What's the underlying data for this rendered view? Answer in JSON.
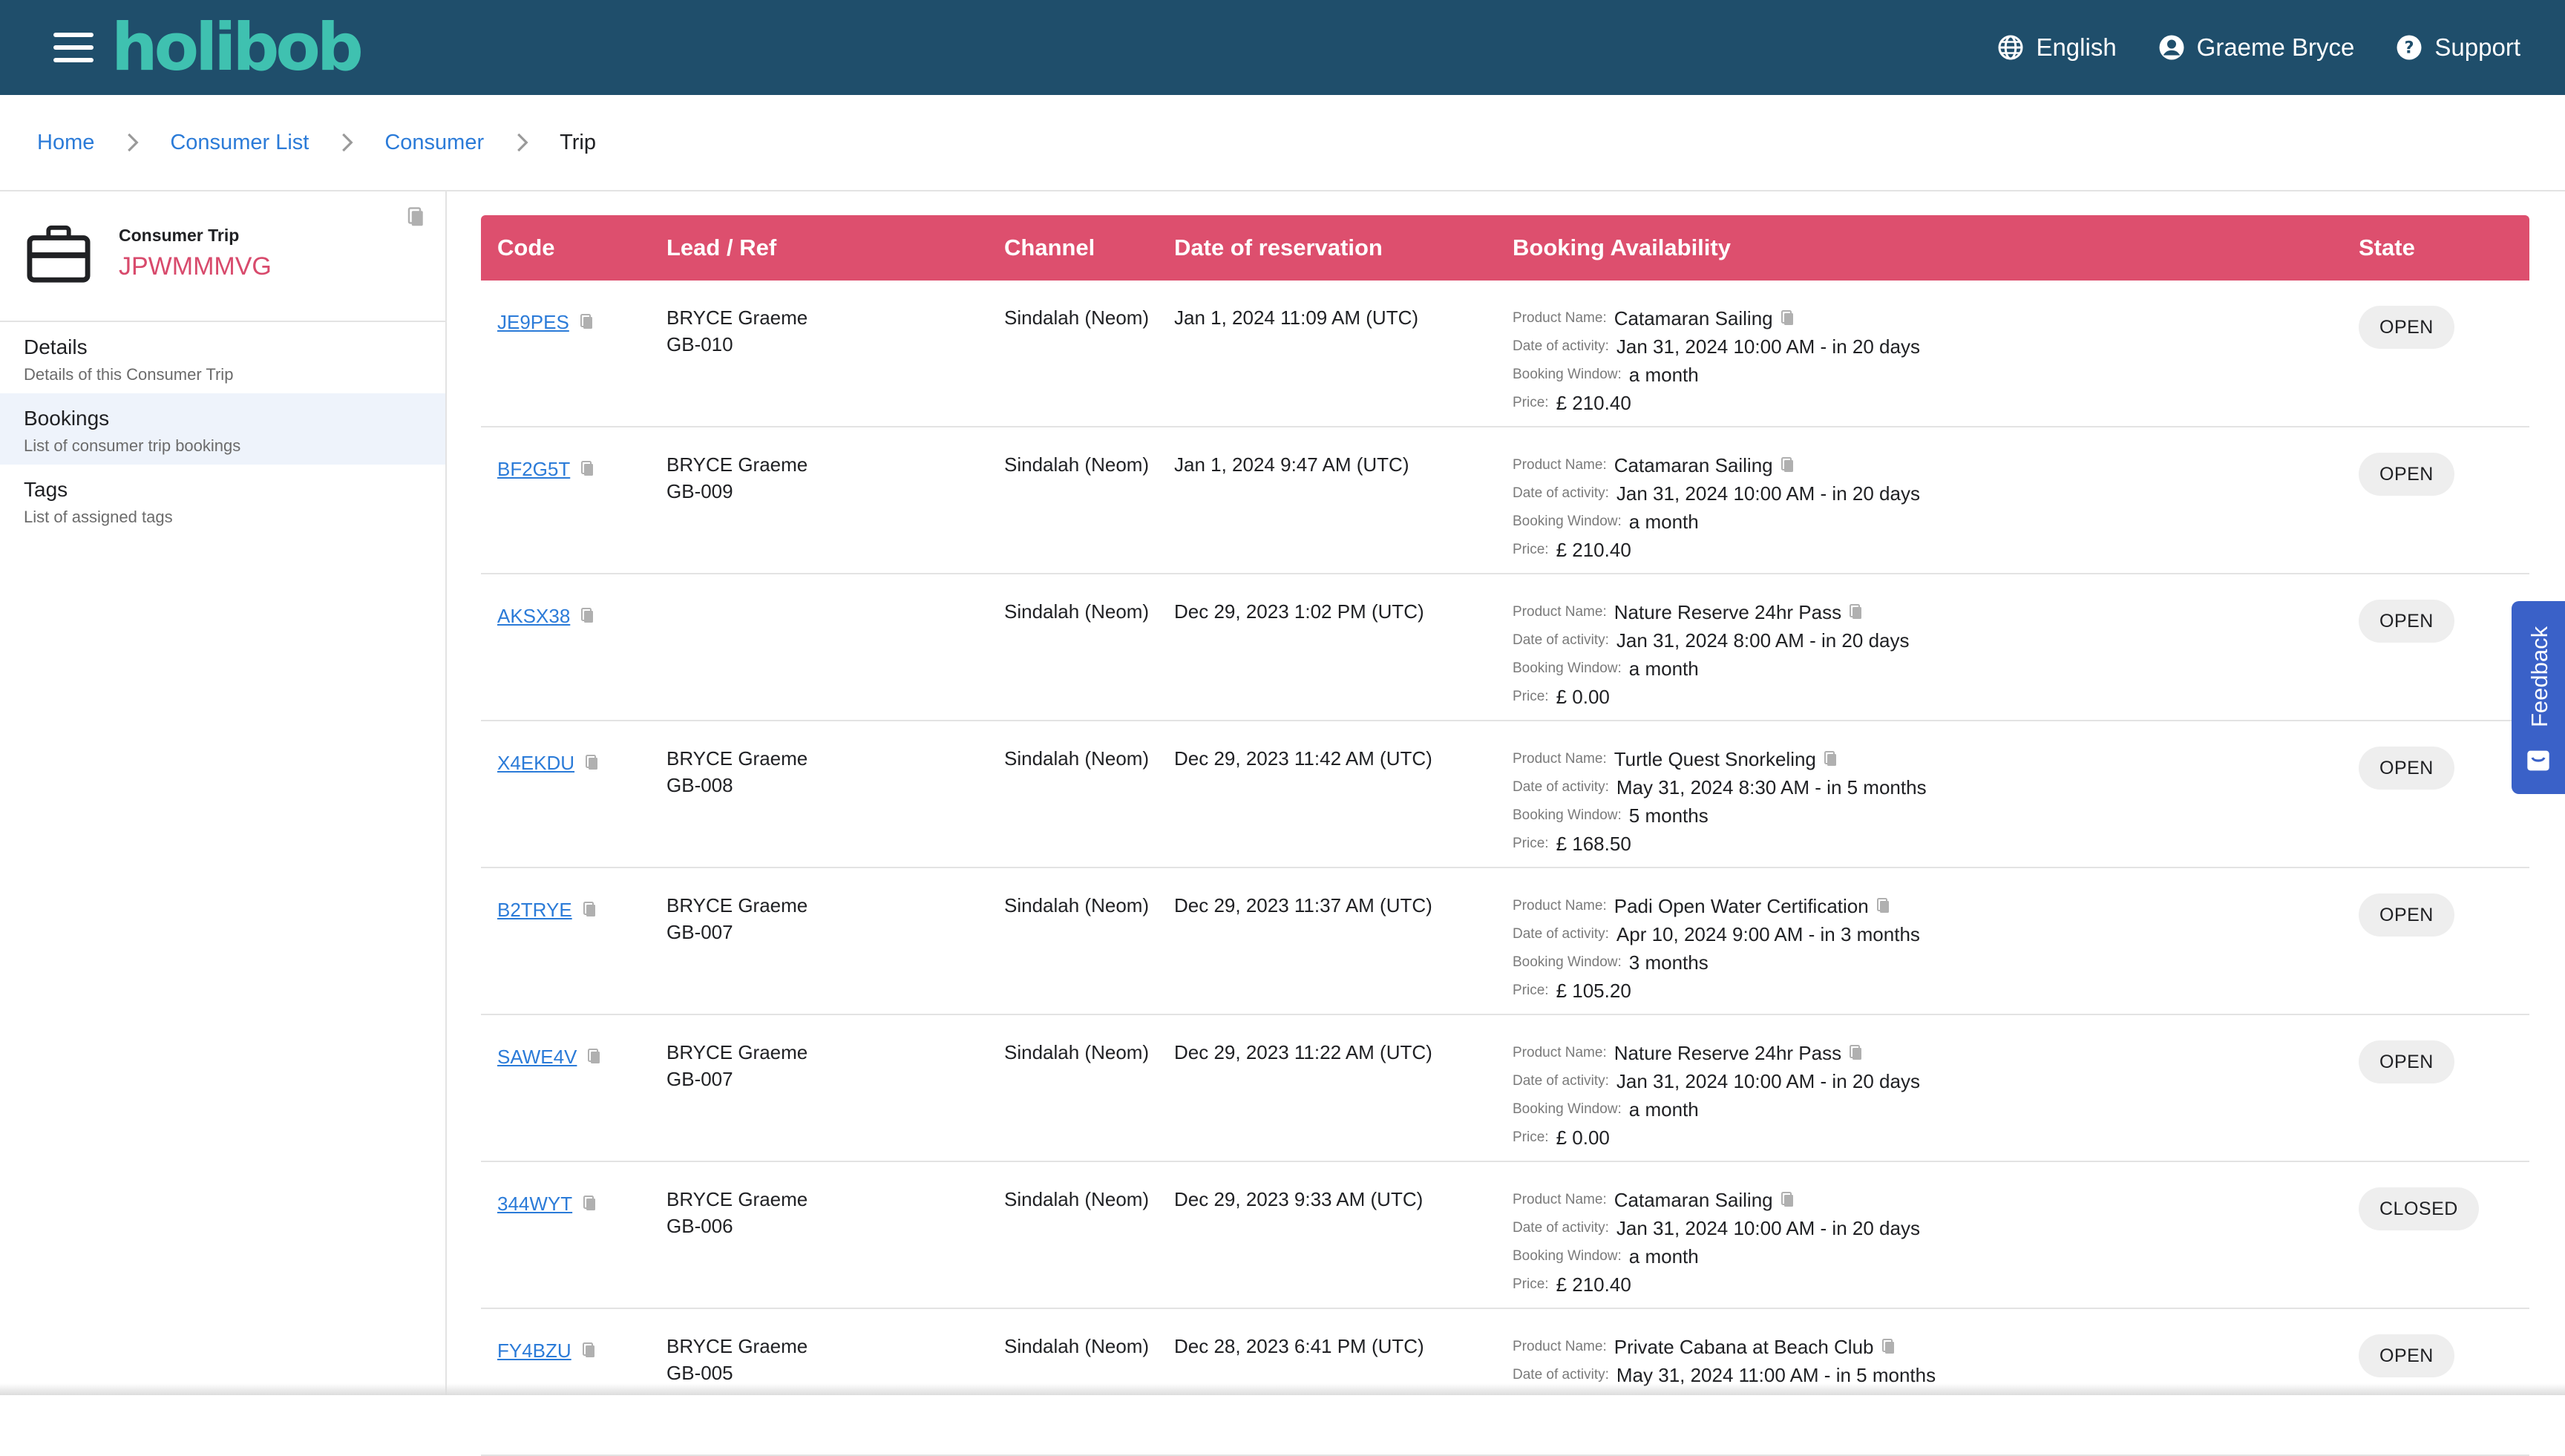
{
  "header": {
    "logo": "holibob",
    "language": "English",
    "user": "Graeme Bryce",
    "support": "Support"
  },
  "breadcrumb": {
    "items": [
      "Home",
      "Consumer List",
      "Consumer"
    ],
    "current": "Trip"
  },
  "sidebar": {
    "trip_label": "Consumer Trip",
    "trip_code": "JPWMMMVG",
    "items": [
      {
        "title": "Details",
        "subtitle": "Details of this Consumer Trip"
      },
      {
        "title": "Bookings",
        "subtitle": "List of consumer trip bookings"
      },
      {
        "title": "Tags",
        "subtitle": "List of assigned tags"
      }
    ]
  },
  "table": {
    "columns": [
      "Code",
      "Lead / Ref",
      "Channel",
      "Date of reservation",
      "Booking Availability",
      "State"
    ],
    "labels": {
      "product": "Product Name:",
      "date": "Date of activity:",
      "window": "Booking Window:",
      "price": "Price:"
    },
    "rows": [
      {
        "code": "JE9PES",
        "lead": "BRYCE Graeme",
        "ref": "GB-010",
        "channel": "Sindalah (Neom)",
        "date": "Jan 1, 2024 11:09 AM (UTC)",
        "product": "Catamaran Sailing",
        "activity": "Jan 31, 2024 10:00 AM - in 20 days",
        "window": "a month",
        "price": "£ 210.40",
        "state": "OPEN"
      },
      {
        "code": "BF2G5T",
        "lead": "BRYCE Graeme",
        "ref": "GB-009",
        "channel": "Sindalah (Neom)",
        "date": "Jan 1, 2024 9:47 AM (UTC)",
        "product": "Catamaran Sailing",
        "activity": "Jan 31, 2024 10:00 AM - in 20 days",
        "window": "a month",
        "price": "£ 210.40",
        "state": "OPEN"
      },
      {
        "code": "AKSX38",
        "lead": "",
        "ref": "",
        "channel": "Sindalah (Neom)",
        "date": "Dec 29, 2023 1:02 PM (UTC)",
        "product": "Nature Reserve 24hr Pass",
        "activity": "Jan 31, 2024 8:00 AM - in 20 days",
        "window": "a month",
        "price": "£ 0.00",
        "state": "OPEN"
      },
      {
        "code": "X4EKDU",
        "lead": "BRYCE Graeme",
        "ref": "GB-008",
        "channel": "Sindalah (Neom)",
        "date": "Dec 29, 2023 11:42 AM (UTC)",
        "product": "Turtle Quest Snorkeling",
        "activity": "May 31, 2024 8:30 AM - in 5 months",
        "window": "5 months",
        "price": "£ 168.50",
        "state": "OPEN"
      },
      {
        "code": "B2TRYE",
        "lead": "BRYCE Graeme",
        "ref": "GB-007",
        "channel": "Sindalah (Neom)",
        "date": "Dec 29, 2023 11:37 AM (UTC)",
        "product": "Padi Open Water Certification",
        "activity": "Apr 10, 2024 9:00 AM - in 3 months",
        "window": "3 months",
        "price": "£ 105.20",
        "state": "OPEN"
      },
      {
        "code": "SAWE4V",
        "lead": "BRYCE Graeme",
        "ref": "GB-007",
        "channel": "Sindalah (Neom)",
        "date": "Dec 29, 2023 11:22 AM (UTC)",
        "product": "Nature Reserve 24hr Pass",
        "activity": "Jan 31, 2024 10:00 AM - in 20 days",
        "window": "a month",
        "price": "£ 0.00",
        "state": "OPEN"
      },
      {
        "code": "344WYT",
        "lead": "BRYCE Graeme",
        "ref": "GB-006",
        "channel": "Sindalah (Neom)",
        "date": "Dec 29, 2023 9:33 AM (UTC)",
        "product": "Catamaran Sailing",
        "activity": "Jan 31, 2024 10:00 AM - in 20 days",
        "window": "a month",
        "price": "£ 210.40",
        "state": "CLOSED"
      },
      {
        "code": "FY4BZU",
        "lead": "BRYCE Graeme",
        "ref": "GB-005",
        "channel": "Sindalah (Neom)",
        "date": "Dec 28, 2023 6:41 PM (UTC)",
        "product": "Private Cabana at Beach Club",
        "activity": "May 31, 2024 11:00 AM - in 5 months",
        "window": "",
        "price": "",
        "state": "OPEN"
      }
    ]
  },
  "feedback": {
    "label": "Feedback"
  },
  "colors": {
    "header_bg": "#1f4e6b",
    "logo": "#3fc1b0",
    "table_header": "#dd4f6e",
    "link": "#2b7bd8",
    "trip_code": "#d84a6c",
    "feedback": "#3a61c8"
  }
}
